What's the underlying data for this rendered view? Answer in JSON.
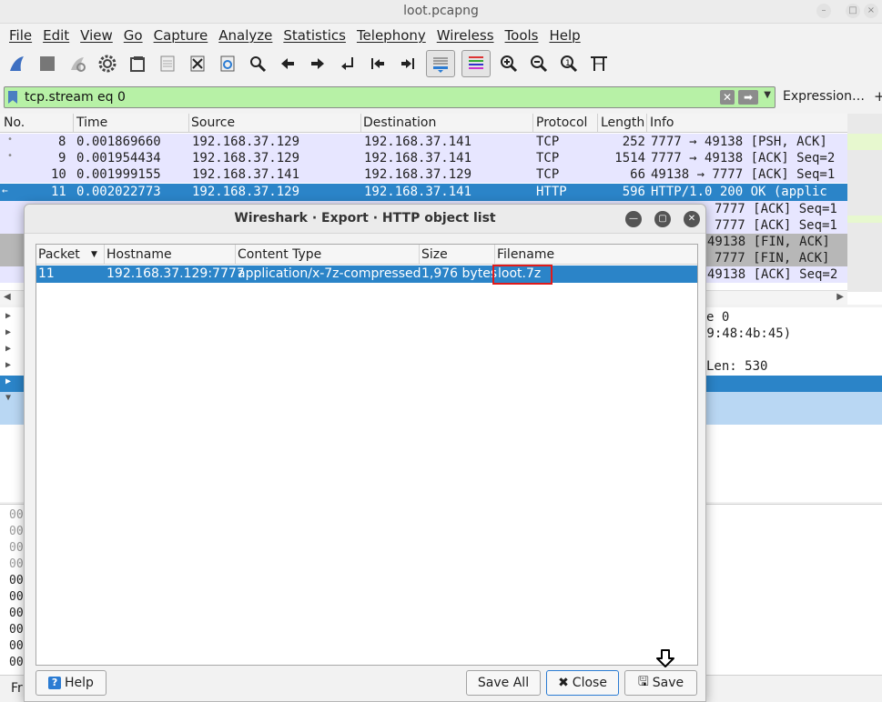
{
  "window": {
    "title": "loot.pcapng"
  },
  "menu": [
    "File",
    "Edit",
    "View",
    "Go",
    "Capture",
    "Analyze",
    "Statistics",
    "Telephony",
    "Wireless",
    "Tools",
    "Help"
  ],
  "toolbar": {
    "icons": [
      "shark-fin-icon",
      "stop-icon",
      "restart-icon",
      "options-gear-icon",
      "open-file-icon",
      "save-file-icon",
      "close-file-icon",
      "reload-icon",
      "find-icon",
      "go-back-icon",
      "go-forward-icon",
      "go-to-packet-icon",
      "first-packet-icon",
      "last-packet-icon",
      "autoscroll-icon",
      "colorize-icon",
      "zoom-in-icon",
      "zoom-out-icon",
      "zoom-reset-icon",
      "resize-columns-icon"
    ]
  },
  "filter": {
    "value": "tcp.stream eq 0",
    "expression_label": "Expression…",
    "plus_label": "+",
    "bg_color": "#b7f1a6"
  },
  "packet_list": {
    "columns": [
      "No.",
      "Time",
      "Source",
      "Destination",
      "Protocol",
      "Length",
      "Info"
    ],
    "rows": [
      {
        "no": "8",
        "time": "0.001869660",
        "src": "192.168.37.129",
        "dst": "192.168.37.141",
        "proto": "TCP",
        "len": "252",
        "info": "7777 → 49138 [PSH, ACK]"
      },
      {
        "no": "9",
        "time": "0.001954434",
        "src": "192.168.37.129",
        "dst": "192.168.37.141",
        "proto": "TCP",
        "len": "1514",
        "info": "7777 → 49138 [ACK] Seq=2"
      },
      {
        "no": "10",
        "time": "0.001999155",
        "src": "192.168.37.141",
        "dst": "192.168.37.129",
        "proto": "TCP",
        "len": "66",
        "info": "49138 → 7777 [ACK] Seq=1"
      },
      {
        "no": "11",
        "time": "0.002022773",
        "src": "192.168.37.129",
        "dst": "192.168.37.141",
        "proto": "HTTP",
        "len": "596",
        "info": "HTTP/1.0 200 OK  (applic"
      }
    ],
    "partial_info": [
      "7777 [ACK] Seq=1",
      "7777 [ACK] Seq=1",
      "49138 [FIN, ACK]",
      "7777 [FIN, ACK]",
      "49138 [ACK] Seq=2"
    ]
  },
  "details": {
    "fragments": [
      "e 0",
      "29:48:4b:45)",
      "Len: 530"
    ]
  },
  "bytes": {
    "offsets": [
      "00",
      "00",
      "00",
      "00",
      "00",
      "00",
      "00",
      "00",
      "00",
      "00"
    ]
  },
  "status": {
    "text": "Fr"
  },
  "dialog": {
    "title": "Wireshark · Export · HTTP object list",
    "columns": [
      "Packet",
      "Hostname",
      "Content Type",
      "Size",
      "Filename"
    ],
    "rows": [
      {
        "packet": "11",
        "hostname": "192.168.37.129:7777",
        "content_type": "application/x-7z-compressed",
        "size": "1,976 bytes",
        "filename": "loot.7z"
      }
    ],
    "buttons": {
      "help": "Help",
      "save_all": "Save All",
      "close": "Close",
      "save": "Save"
    }
  },
  "colors": {
    "selection": "#2b84c8",
    "row_tcp": "#e7e6ff",
    "highlight_box": "#e01a1a"
  }
}
